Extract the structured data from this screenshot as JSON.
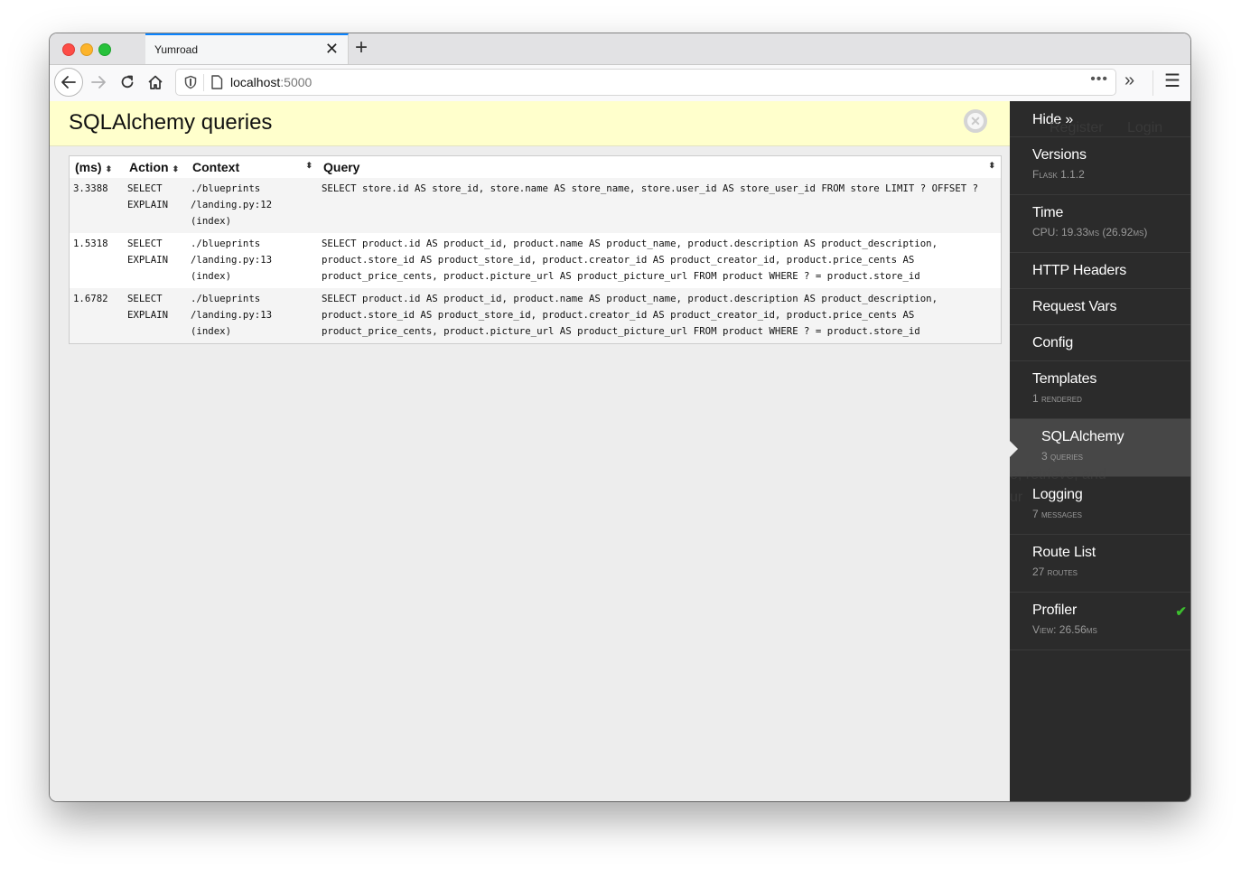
{
  "browser": {
    "tab_title": "Yumroad",
    "tab_close": "✕",
    "new_tab": "+",
    "url_host": "localhost",
    "url_port": ":5000",
    "url_more": "•••",
    "overflow": "»",
    "menu": "☰",
    "icons": {
      "back": "arrow-left-icon",
      "forward": "arrow-right-icon",
      "reload": "reload-icon",
      "home": "home-icon"
    }
  },
  "panel": {
    "title": "SQLAlchemy queries",
    "close": "✕",
    "table": {
      "headers": [
        "(ms)",
        "Action",
        "Context",
        "Query"
      ],
      "sort_glyph": "⬍",
      "rows": [
        {
          "ms": "3.3388",
          "action": [
            "SELECT",
            "EXPLAIN"
          ],
          "context": [
            "./blueprints",
            "/landing.py:12",
            "(index)"
          ],
          "query": "SELECT store.id AS store_id, store.name AS store_name, store.user_id AS store_user_id FROM store LIMIT ? OFFSET ?"
        },
        {
          "ms": "1.5318",
          "action": [
            "SELECT",
            "EXPLAIN"
          ],
          "context": [
            "./blueprints",
            "/landing.py:13",
            "(index)"
          ],
          "query": "SELECT product.id AS product_id, product.name AS product_name, product.description AS product_description, product.store_id AS product_store_id, product.creator_id AS product_creator_id, product.price_cents AS product_price_cents, product.picture_url AS product_picture_url FROM product WHERE ? = product.store_id"
        },
        {
          "ms": "1.6782",
          "action": [
            "SELECT",
            "EXPLAIN"
          ],
          "context": [
            "./blueprints",
            "/landing.py:13",
            "(index)"
          ],
          "query": "SELECT product.id AS product_id, product.name AS product_name, product.description AS product_description, product.store_id AS product_store_id, product.creator_id AS product_creator_id, product.price_cents AS product_price_cents, product.picture_url AS product_picture_url FROM product WHERE ? = product.store_id"
        }
      ]
    }
  },
  "sidebar": {
    "hide": "Hide »",
    "items": [
      {
        "title": "Versions",
        "sub": "Flask 1.1.2"
      },
      {
        "title": "Time",
        "sub": "CPU: 19.33ms (26.92ms)"
      },
      {
        "title": "HTTP Headers",
        "sub": null
      },
      {
        "title": "Request Vars",
        "sub": null
      },
      {
        "title": "Config",
        "sub": null
      },
      {
        "title": "Templates",
        "sub": "1 rendered"
      },
      {
        "title": "SQLAlchemy",
        "sub": "3 queries",
        "active": true
      },
      {
        "title": "Logging",
        "sub": "7 messages"
      },
      {
        "title": "Route List",
        "sub": "27 routes"
      },
      {
        "title": "Profiler",
        "sub": "View: 26.56ms",
        "checked": true
      }
    ],
    "check_glyph": "✔"
  },
  "background_page": {
    "nav_register": "Register",
    "nav_login": "Login",
    "text_fragment_1": "e, retrieve, and",
    "text_fragment_2": "ur"
  }
}
